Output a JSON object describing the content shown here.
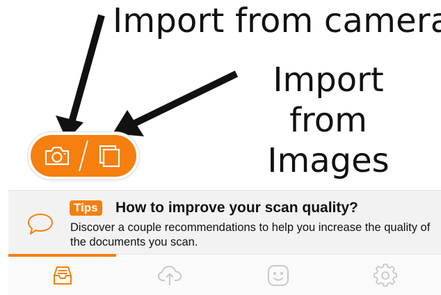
{
  "annotations": {
    "camera": "Import from camera",
    "images": "Import from Images"
  },
  "import_pill": {
    "camera_button": "camera-icon",
    "images_button": "images-icon"
  },
  "tips": {
    "badge": "Tips",
    "title": "How to improve your scan quality?",
    "body": "Discover a couple recommendations to help you increase the quality of the documents you scan.",
    "icon": "speech-bubble-icon"
  },
  "tab_bar": {
    "tabs": [
      {
        "icon": "inbox-tray-icon",
        "active": true
      },
      {
        "icon": "cloud-upload-icon",
        "active": false
      },
      {
        "icon": "smiley-face-icon",
        "active": false
      },
      {
        "icon": "gear-icon",
        "active": false
      }
    ]
  },
  "colors": {
    "accent": "#f57f0f",
    "inactive_icon": "#c8c8c8",
    "card_background": "#f2f2f2"
  }
}
